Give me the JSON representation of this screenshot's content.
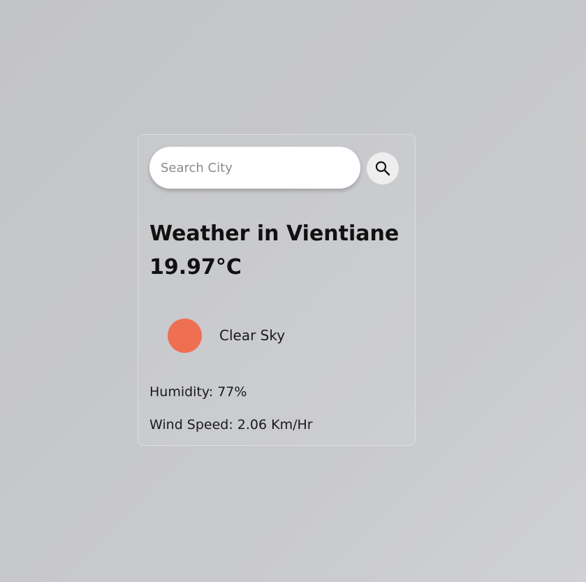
{
  "search": {
    "placeholder": "Search City",
    "value": "",
    "button_icon": "search-icon"
  },
  "weather": {
    "title": "Weather in Vientiane",
    "temperature": "19.97°C",
    "icon": "sun-icon",
    "icon_color": "#ef6f52",
    "description": "Clear Sky",
    "humidity": "Humidity: 77%",
    "wind_speed": "Wind Speed: 2.06 Km/Hr"
  }
}
